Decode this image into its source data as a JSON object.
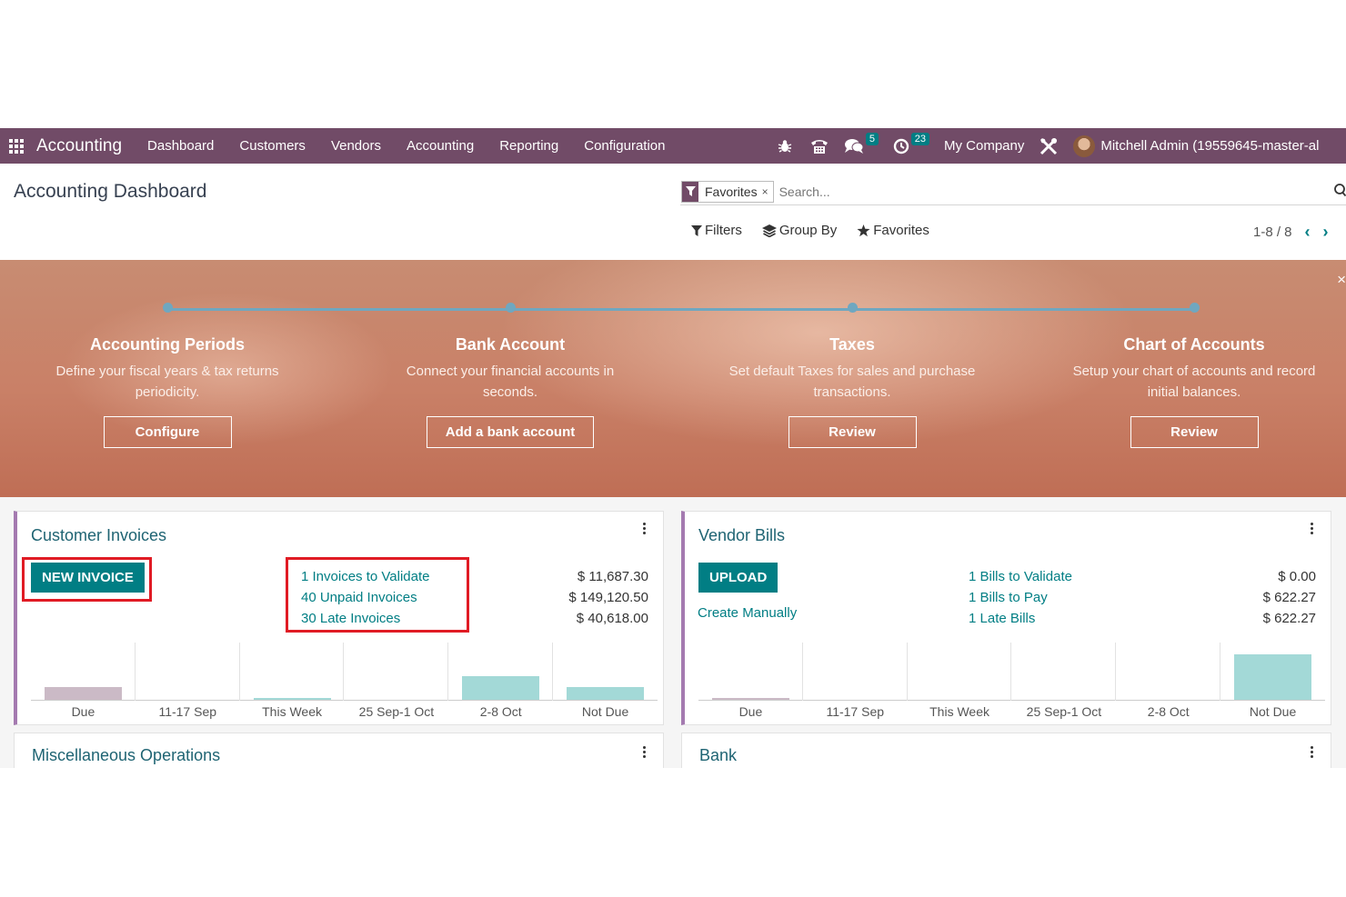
{
  "navbar": {
    "app_name": "Accounting",
    "menu": [
      "Dashboard",
      "Customers",
      "Vendors",
      "Accounting",
      "Reporting",
      "Configuration"
    ],
    "messages_count": "5",
    "activities_count": "23",
    "company": "My Company",
    "user": "Mitchell Admin (19559645-master-al"
  },
  "control_panel": {
    "title": "Accounting Dashboard",
    "facet_value": "Favorites",
    "facet_remove": "×",
    "search_placeholder": "Search...",
    "filters_label": "Filters",
    "groupby_label": "Group By",
    "favorites_label": "Favorites",
    "pager": "1-8 / 8"
  },
  "onboarding": {
    "close": "×",
    "steps": [
      {
        "title": "Accounting Periods",
        "desc": "Define your fiscal years & tax returns periodicity.",
        "button": "Configure"
      },
      {
        "title": "Bank Account",
        "desc": "Connect your financial accounts in seconds.",
        "button": "Add a bank account"
      },
      {
        "title": "Taxes",
        "desc": "Set default Taxes for sales and purchase transactions.",
        "button": "Review"
      },
      {
        "title": "Chart of Accounts",
        "desc": "Setup your chart of accounts and record initial balances.",
        "button": "Review"
      }
    ]
  },
  "customer_invoices": {
    "title": "Customer Invoices",
    "button": "NEW INVOICE",
    "links": [
      "1 Invoices to Validate",
      "40 Unpaid Invoices",
      "30 Late Invoices"
    ],
    "amounts": [
      "$ 11,687.30",
      "$ 149,120.50",
      "$ 40,618.00"
    ]
  },
  "vendor_bills": {
    "title": "Vendor Bills",
    "button": "UPLOAD",
    "create_link": "Create Manually",
    "links": [
      "1 Bills to Validate",
      "1 Bills to Pay",
      "1 Late Bills"
    ],
    "amounts": [
      "$ 0.00",
      "$ 622.27",
      "$ 622.27"
    ]
  },
  "misc_card": {
    "title": "Miscellaneous Operations"
  },
  "bank_card": {
    "title": "Bank"
  },
  "colors": {
    "navbar": "#714b67",
    "primary": "#017e84",
    "past_due_bar": "#cbbac6",
    "future_bar": "#a3d9d7",
    "highlight": "#e01b24"
  },
  "chart_data": [
    {
      "type": "bar",
      "categories": [
        "Due",
        "11-17 Sep",
        "This Week",
        "25 Sep-1 Oct",
        "2-8 Oct",
        "Not Due"
      ],
      "values": [
        0.27,
        0,
        0.02,
        0,
        0.52,
        0.27
      ],
      "ylim": [
        0,
        1
      ]
    },
    {
      "type": "bar",
      "categories": [
        "Due",
        "11-17 Sep",
        "This Week",
        "25 Sep-1 Oct",
        "2-8 Oct",
        "Not Due"
      ],
      "values": [
        0.02,
        0,
        0,
        0,
        0,
        1
      ],
      "ylim": [
        0,
        1
      ]
    }
  ]
}
